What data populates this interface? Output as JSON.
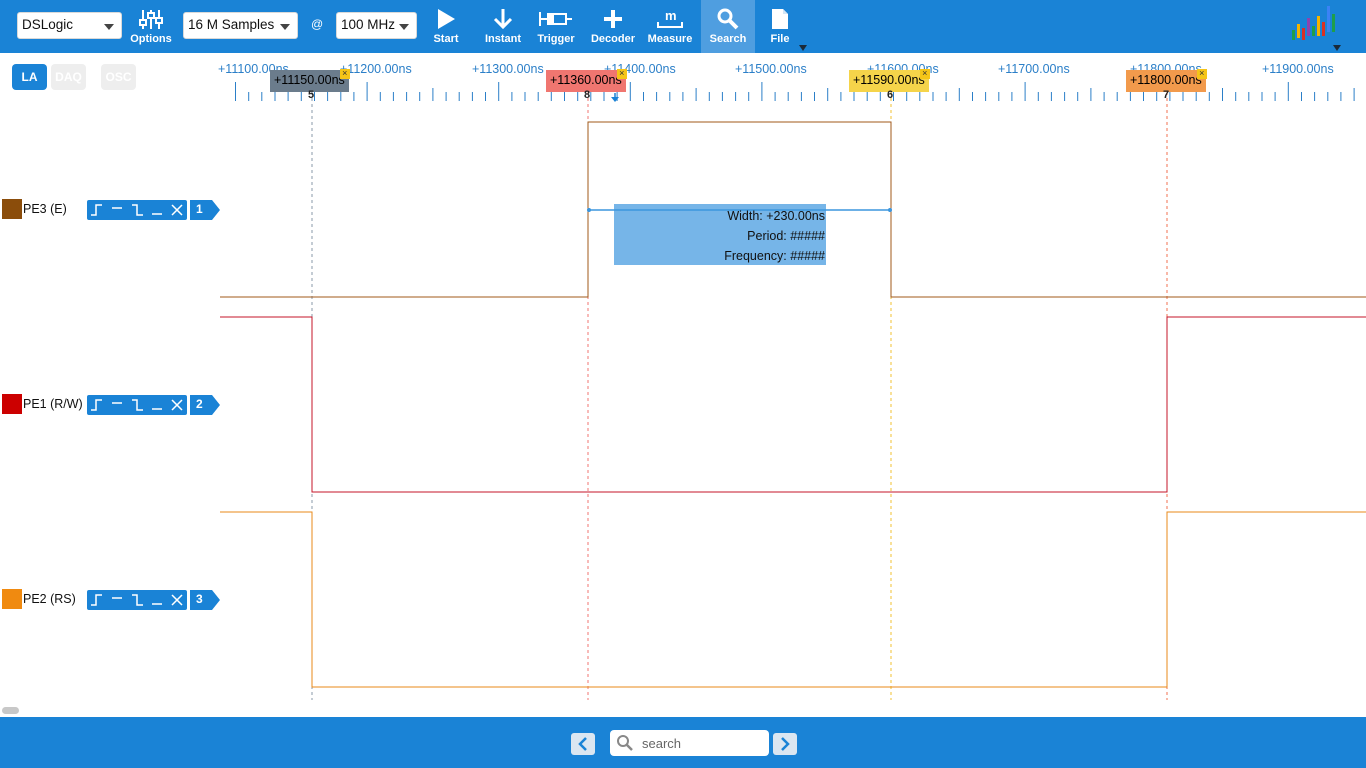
{
  "toolbar": {
    "device": "DSLogic",
    "samples": "16 M Samples",
    "at": "@",
    "rate": "100 MHz",
    "buttons": {
      "options": "Options",
      "start": "Start",
      "instant": "Instant",
      "trigger": "Trigger",
      "decoder": "Decoder",
      "measure": "Measure",
      "search": "Search",
      "file": "File"
    },
    "active_button": "search",
    "colors": {
      "bar": "#1a83d6",
      "active": "#4f9ee0"
    }
  },
  "modes": [
    {
      "label": "LA",
      "active": true
    },
    {
      "label": "DAQ",
      "active": false
    },
    {
      "label": "OSC",
      "active": false
    }
  ],
  "ruler": {
    "labels": [
      "+11100.00ns",
      "+11200.00ns",
      "+11300.00ns",
      "+11400.00ns",
      "+11500.00ns",
      "+11600.00ns",
      "+11700.00ns",
      "+11800.00ns",
      "+11900.00ns"
    ]
  },
  "cursors": [
    {
      "time": "+11150.00ns",
      "number": "5",
      "color": "#6b7c8c"
    },
    {
      "time": "+11360.00ns",
      "number": "8",
      "color": "#f07670"
    },
    {
      "time": "+11590.00ns",
      "number": "6",
      "color": "#f5d44a"
    },
    {
      "time": "+11800.00ns",
      "number": "7",
      "color": "#f29a4c"
    }
  ],
  "channels": [
    {
      "name": "PE3 (E)",
      "index": "1",
      "color": "#8b4d0b"
    },
    {
      "name": "PE1 (R/W)",
      "index": "2",
      "color": "#cc0000"
    },
    {
      "name": "PE2 (RS)",
      "index": "3",
      "color": "#f08a10"
    }
  ],
  "measurement": {
    "width": "Width: +230.00ns",
    "period": "Period: #####",
    "frequency": "Frequency: #####"
  },
  "bottom": {
    "search_placeholder": "search"
  }
}
